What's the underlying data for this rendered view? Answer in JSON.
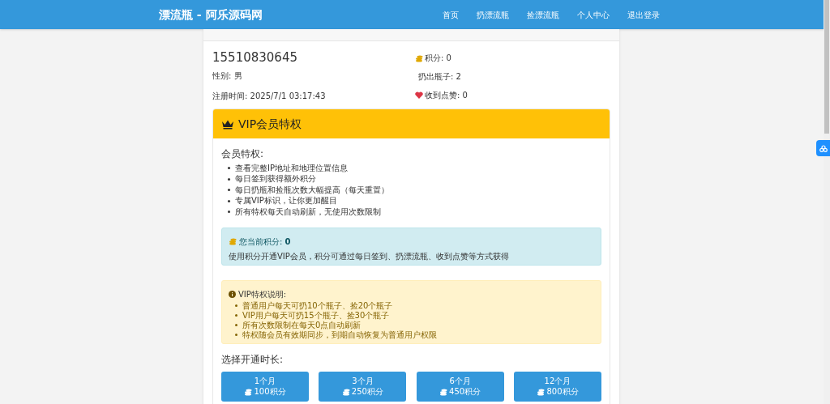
{
  "navbar": {
    "brand": "漂流瓶 - 阿乐源码网",
    "links": [
      {
        "label": "首页",
        "selected": false
      },
      {
        "label": "扔漂流瓶",
        "selected": false
      },
      {
        "label": "捡漂流瓶",
        "selected": false
      },
      {
        "label": "个人中心",
        "selected": false
      },
      {
        "label": "退出登录",
        "selected": false
      }
    ]
  },
  "profile": {
    "phone": "15510830645",
    "gender": "性别: 男",
    "registered": "注册时间: 2025/7/1 03:17:43",
    "points": "积分: 0",
    "bottles": "扔出瓶子: 2",
    "likes": "收到点赞: 0"
  },
  "vip": {
    "title": "VIP会员特权",
    "benefits_title": "会员特权:",
    "benefits": [
      "查看完整IP地址和地理位置信息",
      "每日签到获得额外积分",
      "每日扔瓶和捡瓶次数大幅提高（每天重置）",
      "专属VIP标识，让你更加醒目",
      "所有特权每天自动刷新，无使用次数限制"
    ],
    "points_box": {
      "label": "您当前积分: **0**",
      "note": "使用积分开通VIP会员，积分可通过每日签到、扔漂流瓶、收到点赞等方式获得"
    },
    "notice": {
      "title": "VIP特权说明:",
      "items": [
        "普通用户每天可扔10个瓶子、捡20个瓶子",
        "VIP用户每天可扔15个瓶子、捡30个瓶子",
        "所有次数限制在每天0点自动刷新",
        "特权随会员有效期同步，到期自动恢复为普通用户权限"
      ]
    },
    "duration_title": "选择开通时长:",
    "plans": [
      {
        "duration": "1个月",
        "price": "100积分"
      },
      {
        "duration": "3个月",
        "price": "250积分"
      },
      {
        "duration": "6个月",
        "price": "450积分"
      },
      {
        "duration": "12个月",
        "price": "800积分"
      }
    ]
  }
}
